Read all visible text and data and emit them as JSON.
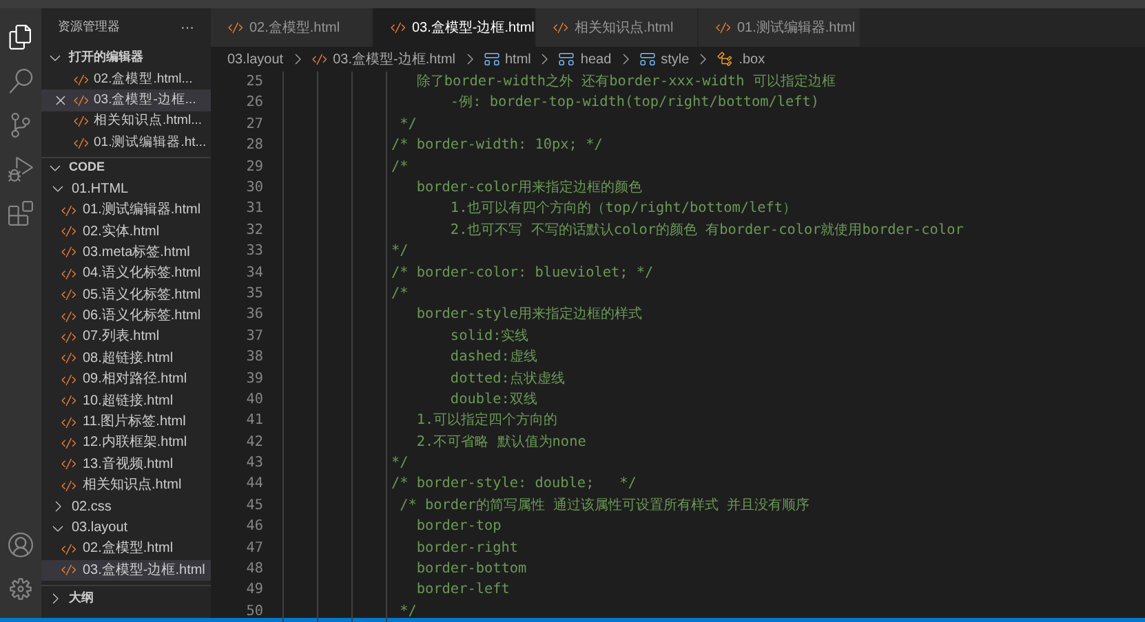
{
  "sidebar": {
    "title": "资源管理器",
    "more": "···",
    "open_editors": {
      "label": "打开的编辑器",
      "expanded": true,
      "items": [
        {
          "name": "02.盒模型.html...",
          "selected": false
        },
        {
          "name": "03.盒模型-边框...",
          "selected": true
        },
        {
          "name": "相关知识点.html...",
          "selected": false
        },
        {
          "name": "01.测试编辑器.ht...",
          "selected": false
        }
      ]
    },
    "workspace": {
      "label": "CODE",
      "expanded": true,
      "children": [
        {
          "kind": "folder",
          "name": "01.HTML",
          "expanded": true,
          "children": [
            {
              "kind": "file",
              "name": "01.测试编辑器.html",
              "selected": false
            },
            {
              "kind": "file",
              "name": "02.实体.html",
              "selected": false
            },
            {
              "kind": "file",
              "name": "03.meta标签.html",
              "selected": false
            },
            {
              "kind": "file",
              "name": "04.语义化标签.html",
              "selected": false
            },
            {
              "kind": "file",
              "name": "05.语义化标签.html",
              "selected": false
            },
            {
              "kind": "file",
              "name": "06.语义化标签.html",
              "selected": false
            },
            {
              "kind": "file",
              "name": "07.列表.html",
              "selected": false
            },
            {
              "kind": "file",
              "name": "08.超链接.html",
              "selected": false
            },
            {
              "kind": "file",
              "name": "09.相对路径.html",
              "selected": false
            },
            {
              "kind": "file",
              "name": "10.超链接.html",
              "selected": false
            },
            {
              "kind": "file",
              "name": "11.图片标签.html",
              "selected": false
            },
            {
              "kind": "file",
              "name": "12.内联框架.html",
              "selected": false
            },
            {
              "kind": "file",
              "name": "13.音视频.html",
              "selected": false
            },
            {
              "kind": "file",
              "name": "相关知识点.html",
              "selected": false
            }
          ]
        },
        {
          "kind": "folder",
          "name": "02.css",
          "expanded": false
        },
        {
          "kind": "folder",
          "name": "03.layout",
          "expanded": true,
          "children": [
            {
              "kind": "file",
              "name": "02.盒模型.html",
              "selected": false
            },
            {
              "kind": "file",
              "name": "03.盒模型-边框.html",
              "selected": true
            }
          ]
        }
      ]
    },
    "outline": {
      "label": "大纲",
      "expanded": false
    }
  },
  "tabs": [
    {
      "label": "02.盒模型.html",
      "selected": false
    },
    {
      "label": "03.盒模型-边框.html",
      "selected": true
    },
    {
      "label": "相关知识点.html",
      "selected": false
    },
    {
      "label": "01.测试编辑器.html",
      "selected": false
    }
  ],
  "breadcrumbs": [
    {
      "kind": "folder",
      "label": "03.layout"
    },
    {
      "kind": "file",
      "label": "03.盒模型-边框.html"
    },
    {
      "kind": "element",
      "label": "html"
    },
    {
      "kind": "element",
      "label": "head"
    },
    {
      "kind": "element",
      "label": "style"
    },
    {
      "kind": "selector",
      "label": ".box"
    }
  ],
  "code": [
    {
      "number": "25",
      "text": "                  除了border-width之外 还有border-xxx-width 可以指定边框"
    },
    {
      "number": "26",
      "text": "                      -例: border-top-width(top/right/bottom/left)"
    },
    {
      "number": "27",
      "text": "                */"
    },
    {
      "number": "28",
      "text": "               /* border-width: 10px; */"
    },
    {
      "number": "29",
      "text": "               /*"
    },
    {
      "number": "30",
      "text": "                  border-color用来指定边框的颜色"
    },
    {
      "number": "31",
      "text": "                      1.也可以有四个方向的（top/right/bottom/left）"
    },
    {
      "number": "32",
      "text": "                      2.也可不写 不写的话默认color的颜色 有border-color就使用border-color"
    },
    {
      "number": "33",
      "text": "               */"
    },
    {
      "number": "34",
      "text": "               /* border-color: blueviolet; */"
    },
    {
      "number": "35",
      "text": "               /*"
    },
    {
      "number": "36",
      "text": "                  border-style用来指定边框的样式"
    },
    {
      "number": "37",
      "text": "                      solid:实线"
    },
    {
      "number": "38",
      "text": "                      dashed:虚线"
    },
    {
      "number": "39",
      "text": "                      dotted:点状虚线"
    },
    {
      "number": "40",
      "text": "                      double:双线"
    },
    {
      "number": "41",
      "text": "                  1.可以指定四个方向的"
    },
    {
      "number": "42",
      "text": "                  2.不可省略 默认值为none"
    },
    {
      "number": "43",
      "text": "               */"
    },
    {
      "number": "44",
      "text": "               /* border-style: double;   */"
    },
    {
      "number": "45",
      "text": "                /* border的简写属性 通过该属性可设置所有样式 并且没有顺序"
    },
    {
      "number": "46",
      "text": "                  border-top"
    },
    {
      "number": "47",
      "text": "                  border-right"
    },
    {
      "number": "48",
      "text": "                  border-bottom"
    },
    {
      "number": "49",
      "text": "                  border-left"
    },
    {
      "number": "50",
      "text": "                */"
    }
  ]
}
